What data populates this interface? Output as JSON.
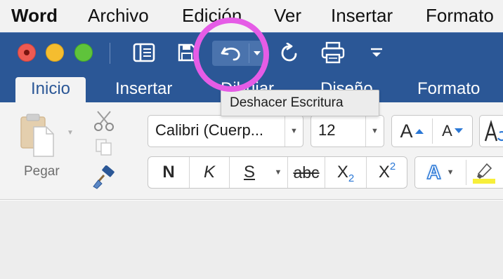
{
  "menubar": {
    "app": "Word",
    "items": [
      "Archivo",
      "Edición",
      "Ver",
      "Insertar",
      "Formato"
    ]
  },
  "quick_access": {
    "icons": [
      "sidebar-icon",
      "save-icon",
      "undo-icon",
      "redo-icon",
      "print-icon",
      "customize-icon"
    ]
  },
  "tabs": [
    "Inicio",
    "Insertar",
    "Dibujar",
    "Diseño",
    "Formato"
  ],
  "active_tab": "Inicio",
  "clipboard": {
    "paste_label": "Pegar"
  },
  "font": {
    "family": "Calibri (Cuerp...",
    "size": "12",
    "grow_label": "A",
    "shrink_label": "A"
  },
  "format_buttons": {
    "bold": "N",
    "italic": "K",
    "underline": "S",
    "strikethrough": "abc",
    "subscript_base": "X",
    "subscript_mark": "2",
    "superscript_base": "X",
    "superscript_mark": "2",
    "text_effects": "A"
  },
  "tooltip": "Deshacer Escritura",
  "colors": {
    "ribbon_blue": "#2b5796",
    "accent_ring": "#e55ce6",
    "highlight_yellow": "#f7ef3a"
  }
}
